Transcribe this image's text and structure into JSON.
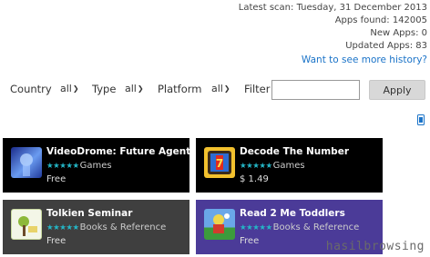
{
  "stats": {
    "latest_scan": "Latest scan: Tuesday, 31 December 2013",
    "apps_found": "Apps found: 142005",
    "new_apps": "New Apps: 0",
    "updated_apps": "Updated Apps: 83"
  },
  "history_link": "Want to see more history?",
  "filters": {
    "country_label": "Country",
    "country_value": "all",
    "type_label": "Type",
    "type_value": "all",
    "platform_label": "Platform",
    "platform_value": "all",
    "filter_label": "Filter",
    "filter_value": "",
    "apply_label": "Apply"
  },
  "icons": {
    "mobile": "mobile-phone-icon",
    "rating": "star-rating-icon",
    "chevron": "chevron-down-icon"
  },
  "colors": {
    "link": "#1a73c8",
    "stars": "#24b6c6",
    "card_black": "#000000",
    "card_gray": "#3f3f3f",
    "card_purple": "#4b3b98"
  },
  "apps": [
    {
      "title": "VideoDrome: Future Agent Tra",
      "category": "Games",
      "price": "Free",
      "rating": 5
    },
    {
      "title": "Decode The Number",
      "category": "Games",
      "price": "$ 1.49",
      "rating": 5
    },
    {
      "title": "Tolkien Seminar",
      "category": "Books & Reference",
      "price": "Free",
      "rating": 5
    },
    {
      "title": "Read 2 Me Toddlers",
      "category": "Books & Reference",
      "price": "Free",
      "rating": 5
    }
  ],
  "watermark": "hasilbrowsing"
}
